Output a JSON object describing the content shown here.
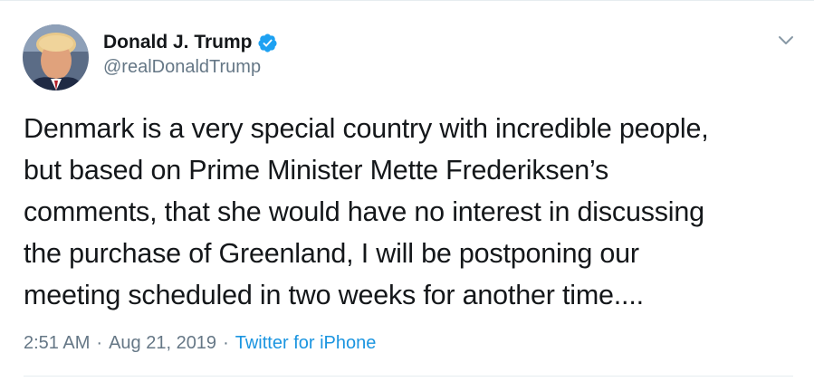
{
  "author": {
    "display_name": "Donald J. Trump",
    "handle": "@realDonaldTrump",
    "verified": true
  },
  "tweet": {
    "text": "Denmark is a very special country with incredible people,\nbut based on Prime Minister Mette Frederiksen’s\ncomments, that she would have no interest in discussing\nthe purchase of Greenland, I will be postponing our\nmeeting scheduled in two weeks for another time...."
  },
  "meta": {
    "time": "2:51 AM",
    "separator_1": "·",
    "date": "Aug 21, 2019",
    "separator_2": "·",
    "source": "Twitter for iPhone"
  },
  "icons": {
    "verified": "verified-badge-icon",
    "more": "chevron-down-icon"
  },
  "colors": {
    "text": "#14171a",
    "secondary": "#657786",
    "link": "#1b95e0",
    "verified_badge": "#1da1f2",
    "divider": "#e6ecf0"
  }
}
